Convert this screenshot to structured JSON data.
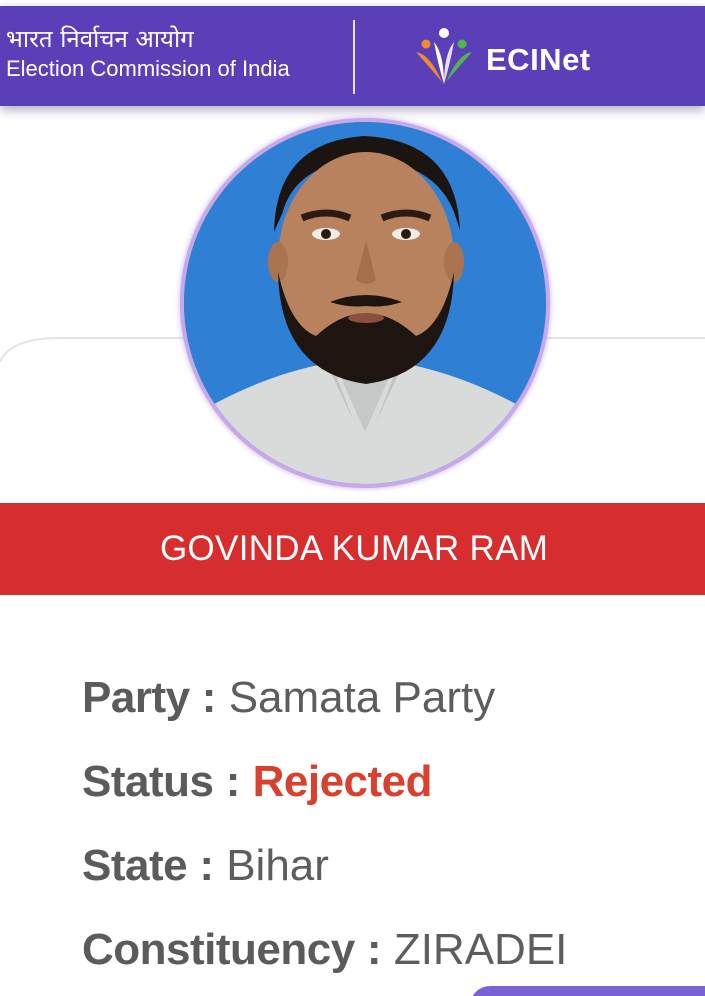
{
  "header": {
    "org_name_hindi": "भारत निर्वाचन आयोग",
    "org_name_english": "Election Commission of India",
    "app_name": "ECINet",
    "logo_icon": "ecinet-people-logo-icon",
    "background_color": "#5a3fb8"
  },
  "candidate": {
    "photo": "candidate-photo",
    "name": "GOVINDA KUMAR RAM",
    "banner_color": "#d62e2e"
  },
  "details": {
    "party": {
      "label": "Party",
      "separator": " : ",
      "value": "Samata Party"
    },
    "status": {
      "label": "Status",
      "separator": " : ",
      "value": "Rejected",
      "color": "#d9412e"
    },
    "state": {
      "label": "State",
      "separator": " : ",
      "value": "Bihar"
    },
    "constituency": {
      "label": "Constituency",
      "separator": " : ",
      "value": "ZIRADEI"
    }
  }
}
